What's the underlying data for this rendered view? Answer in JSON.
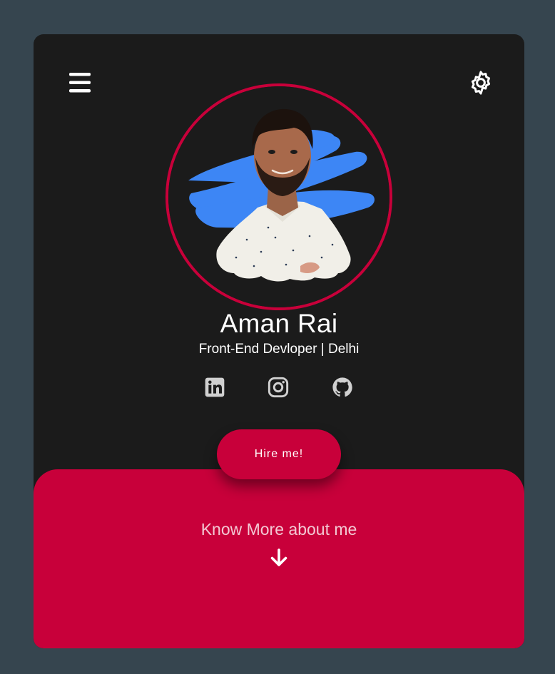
{
  "profile": {
    "name": "Aman Rai",
    "role": "Front-End Devloper | Delhi"
  },
  "header": {
    "menu_icon": "hamburger-menu-icon",
    "settings_icon": "gear-icon"
  },
  "socials": [
    {
      "icon": "linkedin-icon"
    },
    {
      "icon": "instagram-icon"
    },
    {
      "icon": "github-icon"
    }
  ],
  "cta": {
    "hire_label": "Hire me!"
  },
  "footer": {
    "know_more_label": "Know More about me",
    "arrow_icon": "arrow-down-icon"
  },
  "colors": {
    "background": "#36454f",
    "card": "#1b1b1b",
    "accent": "#c8003a",
    "paint_splash": "#3d86f5"
  }
}
